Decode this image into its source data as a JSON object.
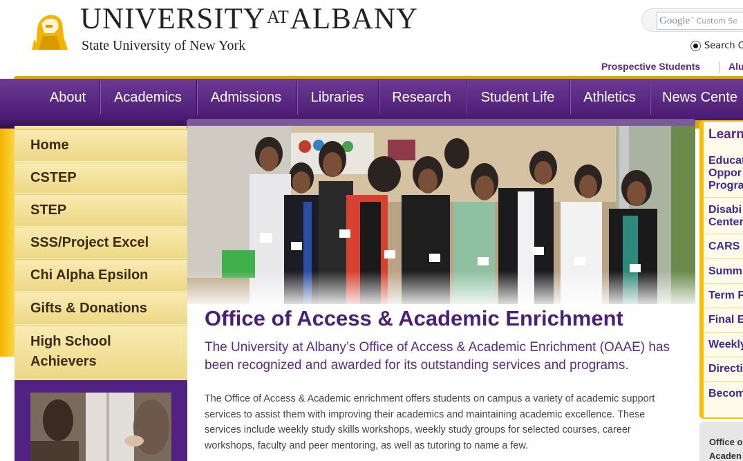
{
  "brand": {
    "title_main": "UNIVERSITY",
    "title_at": "AT",
    "title_end": "ALBANY",
    "subtitle": "State University of New York",
    "colors": {
      "purple": "#5b2a86",
      "gold": "#f5c000",
      "text_dark": "#222222"
    }
  },
  "search": {
    "google_label": "Google",
    "placeholder": "Custom Se",
    "radio_label": "Search C",
    "icon": "radio-selected-icon"
  },
  "utility_nav": {
    "items": [
      {
        "label": "Prospective Students"
      },
      {
        "label": "Alu"
      }
    ]
  },
  "nav": {
    "items": [
      {
        "label": "About"
      },
      {
        "label": "Academics"
      },
      {
        "label": "Admissions"
      },
      {
        "label": "Libraries"
      },
      {
        "label": "Research"
      },
      {
        "label": "Student Life"
      },
      {
        "label": "Athletics"
      },
      {
        "label": "News Cente"
      }
    ]
  },
  "sidebar": {
    "items": [
      {
        "label": "Home"
      },
      {
        "label": "CSTEP"
      },
      {
        "label": "STEP"
      },
      {
        "label": "SSS/Project Excel"
      },
      {
        "label": "Chi Alpha Epsilon"
      },
      {
        "label": "Gifts & Donations"
      },
      {
        "label": "High School",
        "label2": "Achievers"
      }
    ]
  },
  "main": {
    "title": "Office of Access & Academic Enrichment",
    "subtitle": "The University at Albany’s Office of Access & Academic Enrichment (OAAE) has been recognized and awarded for its outstanding services and programs.",
    "body": "The Office of Access & Academic enrichment offers students on campus a variety of academic support services to assist them with improving their academics and maintaining academic excellence. These services include weekly study skills workshops, weekly study groups for selected courses, career workshops, faculty and peer mentoring, as well as tutoring to name a few."
  },
  "right_rail": {
    "heading": "Learn",
    "links": [
      {
        "line1": "Educat",
        "line2": "Oppor",
        "line3": "Progra"
      },
      {
        "line1": "Disabi",
        "line2": "Center"
      },
      {
        "line1": "CARS"
      },
      {
        "line1": "Summ"
      },
      {
        "line1": "Term F"
      },
      {
        "line1": "Final E"
      },
      {
        "line1": "Weekly"
      },
      {
        "line1": "Directi"
      },
      {
        "line1": "Becom"
      }
    ],
    "box_line1": "Office o",
    "box_line2": "Acaden"
  }
}
